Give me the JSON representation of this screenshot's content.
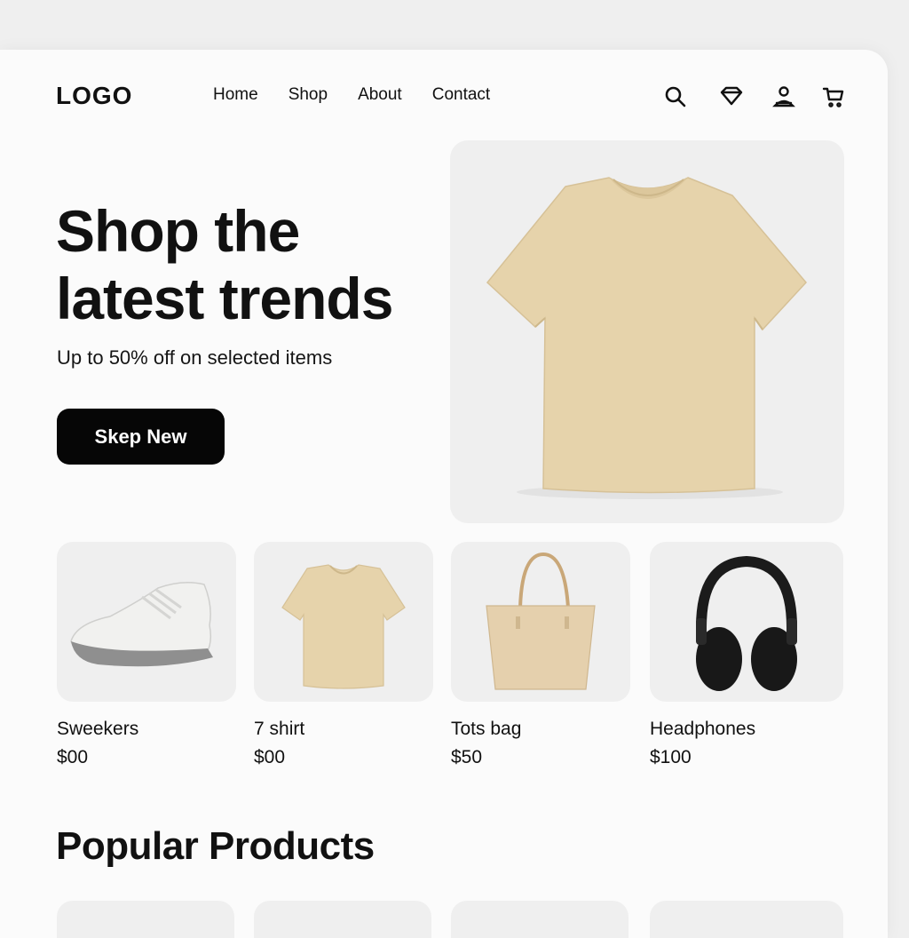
{
  "header": {
    "logo": "LOGO",
    "nav": [
      "Home",
      "Shop",
      "About",
      "Contact"
    ],
    "icons": [
      "search-icon",
      "wishlist-icon",
      "account-icon",
      "cart-icon"
    ]
  },
  "hero": {
    "title": "Shop the latest trends",
    "subtitle": "Up to 50% off on selected items",
    "cta_label": "Skep New"
  },
  "products": [
    {
      "name": "Sweekers",
      "price": "$00"
    },
    {
      "name": "7 shirt",
      "price": "$00"
    },
    {
      "name": "Tots bag",
      "price": "$50"
    },
    {
      "name": "Headphones",
      "price": "$100"
    }
  ],
  "popular": {
    "title": "Popular Products"
  },
  "colors": {
    "accent": "#060606",
    "card_bg": "#efefef",
    "tshirt": "#e6d3ab",
    "bag": "#e5d0ad"
  }
}
